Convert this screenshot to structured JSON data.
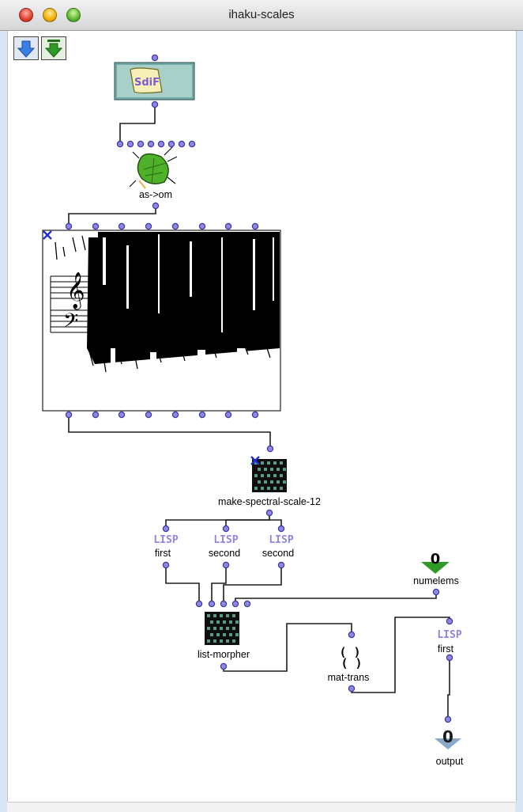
{
  "window": {
    "title": "ihaku-scales"
  },
  "toolbar": {
    "buttons": [
      "blue-down-arrow-icon",
      "green-down-arrow-icon"
    ]
  },
  "nodes": {
    "sdif": {
      "icon": "sdif-scroll-icon",
      "badge": "SdiF"
    },
    "as_om": {
      "label": "as->om",
      "icon": "green-leaf-bug-icon"
    },
    "score": {
      "icon": "chord-seq-score-icon"
    },
    "mss": {
      "label": "make-spectral-scale-12",
      "icon": "grid-patch-icon"
    },
    "first1": {
      "label": "first",
      "lisp": "LISP"
    },
    "second1": {
      "label": "second",
      "lisp": "LISP"
    },
    "second2": {
      "label": "second",
      "lisp": "LISP"
    },
    "numelems": {
      "label": "numelems",
      "value": "0",
      "icon": "green-input-arrow-icon"
    },
    "lm": {
      "label": "list-morpher",
      "icon": "grid-patch-icon"
    },
    "mt": {
      "label": "mat-trans",
      "icon": "bracket-matrix-icon"
    },
    "first2": {
      "label": "first",
      "lisp": "LISP"
    },
    "output": {
      "label": "output",
      "value": "0",
      "icon": "blue-output-arrow-icon"
    }
  },
  "colors": {
    "port": "#8e86e0",
    "wire": "#1d1d1d",
    "leaf": "#4fb02a",
    "grid": "#2b6b55"
  }
}
